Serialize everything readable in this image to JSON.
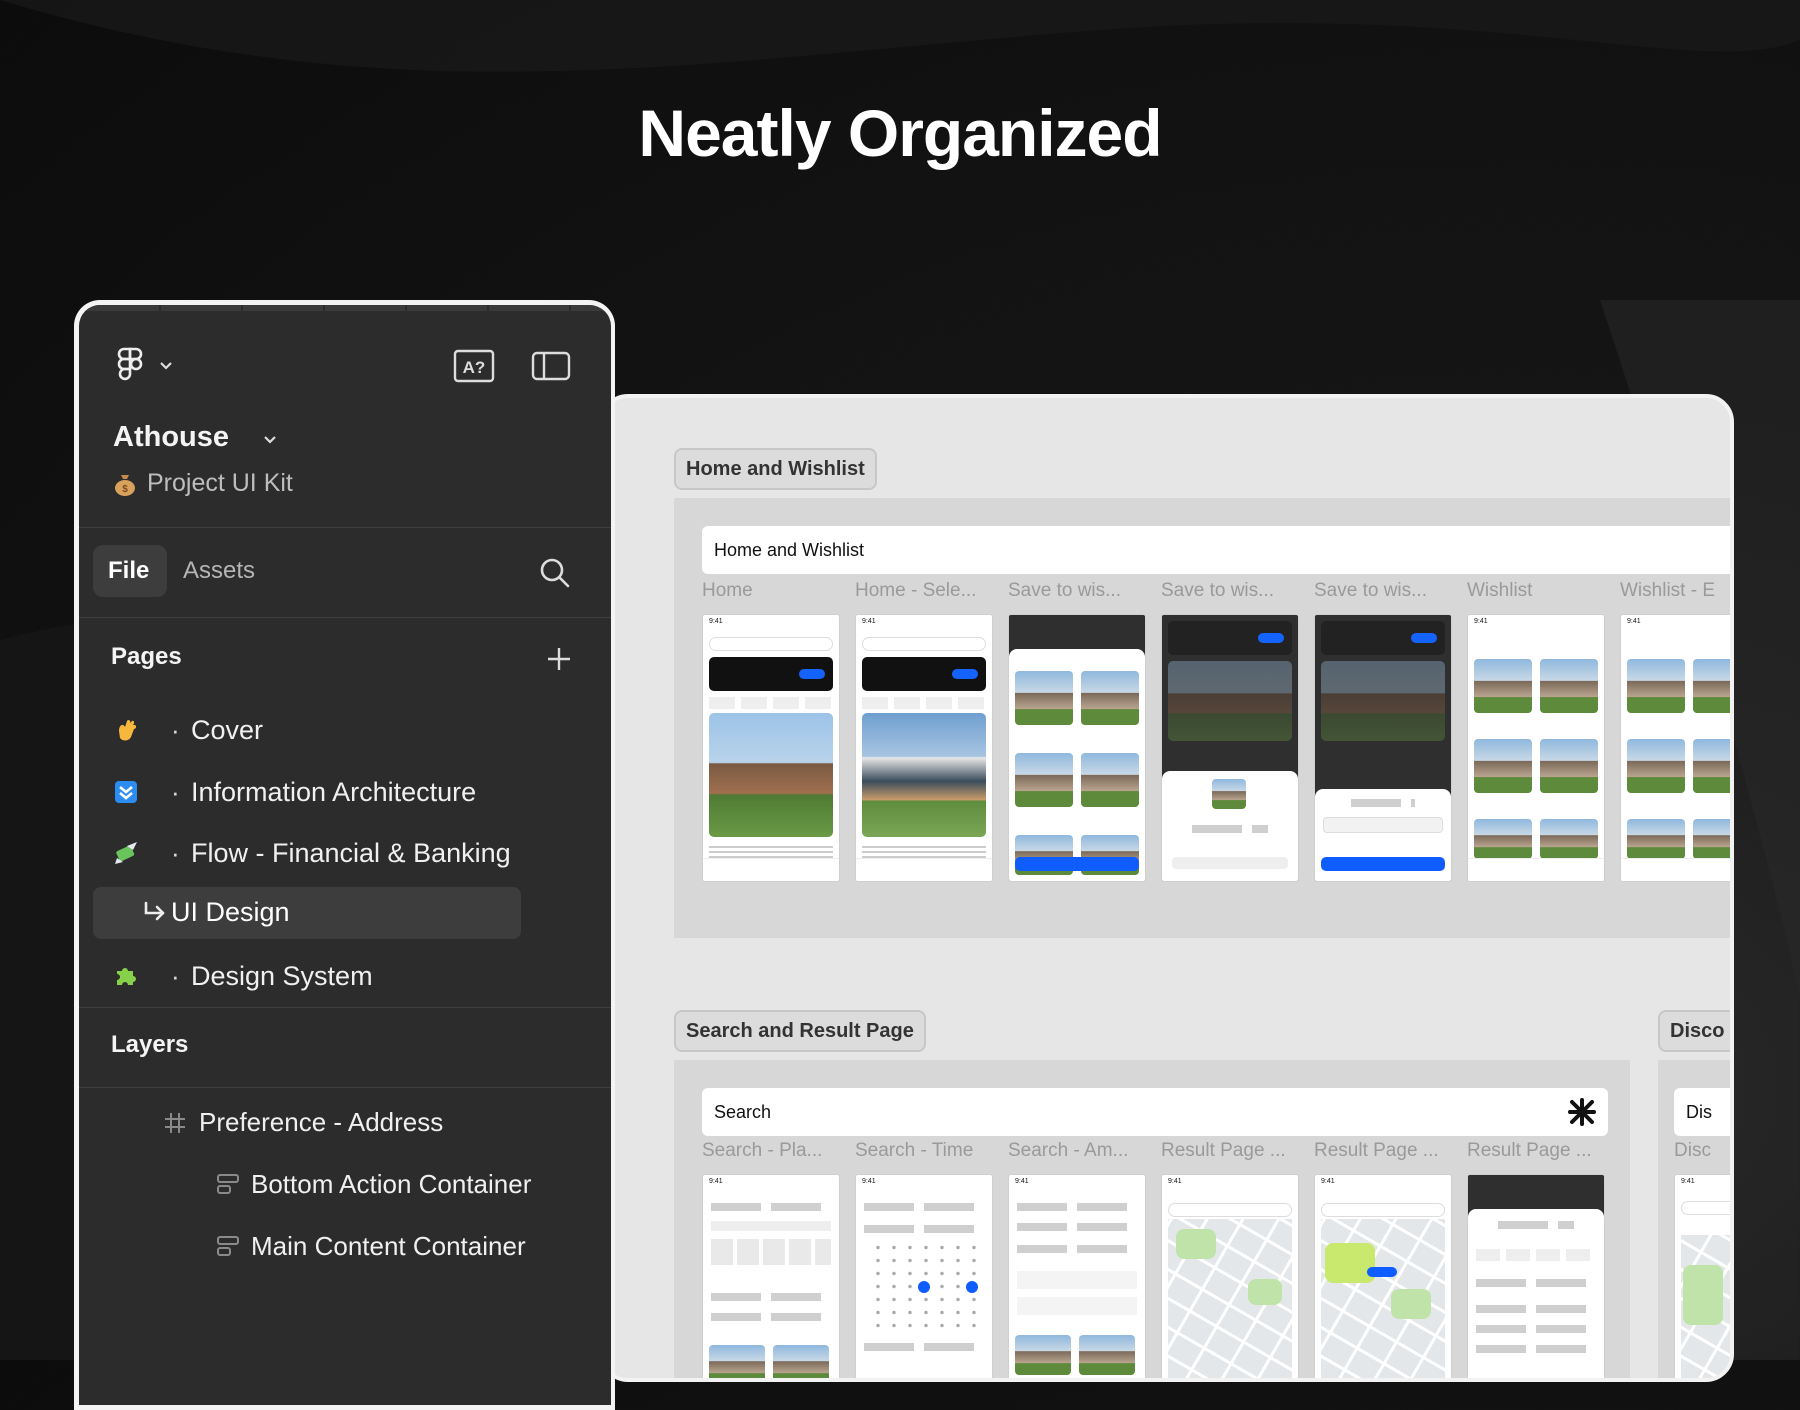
{
  "headline": "Neatly Organized",
  "sidebar": {
    "project_name": "Athouse",
    "project_subtitle": "Project UI Kit",
    "tabs": [
      "File",
      "Assets"
    ],
    "pages_heading": "Pages",
    "pages": [
      {
        "label": "Cover",
        "icon": "waving-hand-icon",
        "bullet": "·"
      },
      {
        "label": "Information Architecture",
        "icon": "blue-arrow-down-icon",
        "bullet": "·"
      },
      {
        "label": "Flow - Financial & Banking",
        "icon": "money-with-wings-icon",
        "bullet": "·"
      },
      {
        "label": "UI Design",
        "icon": "return-arrow-icon",
        "selected": true
      },
      {
        "label": "Design System",
        "icon": "puzzle-piece-icon",
        "bullet": "·"
      }
    ],
    "layers_heading": "Layers",
    "layers": [
      {
        "label": "Preference - Address",
        "icon": "frame-hash-icon"
      },
      {
        "label": "Bottom Action Container",
        "icon": "auto-layout-icon"
      },
      {
        "label": "Main Content Container",
        "icon": "auto-layout-icon"
      }
    ]
  },
  "canvas": {
    "sections": [
      {
        "label": "Home and Wishlist",
        "bar_title": "Home and Wishlist",
        "frames": [
          "Home",
          "Home - Sele...",
          "Save to wis...",
          "Save to wis...",
          "Save to wis...",
          "Wishlist",
          "Wishlist - E"
        ]
      },
      {
        "label": "Search and Result Page",
        "bar_title": "Search",
        "frames": [
          "Search - Pla...",
          "Search - Time",
          "Search - Am...",
          "Result Page ...",
          "Result Page ...",
          "Result Page ..."
        ]
      },
      {
        "label": "Disco",
        "bar_title": "Dis",
        "frames": [
          "Disc"
        ]
      }
    ]
  },
  "colors": {
    "accent": "#0f5cff",
    "sidebar_bg": "#2c2c2c",
    "canvas_bg": "#e6e6e6"
  }
}
